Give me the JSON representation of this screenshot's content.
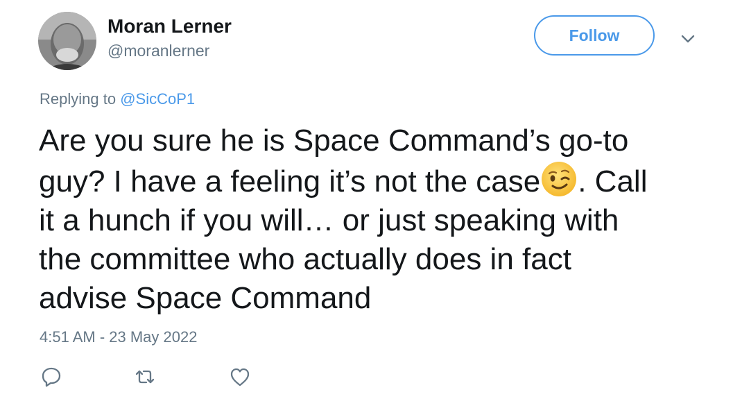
{
  "author": {
    "display_name": "Moran Lerner",
    "handle": "@moranlerner"
  },
  "header": {
    "follow_label": "Follow"
  },
  "reply": {
    "prefix": "Replying to ",
    "mention": "@SicCoP1"
  },
  "tweet": {
    "lines": [
      "Are you sure he is Space Command’s go-to",
      "guy? I have a feeling it’s not the case",
      ". Call",
      "it a hunch if you will… or just speaking with",
      "the committee who actually does in fact",
      "advise Space Command"
    ],
    "emoji_name": "winking-face"
  },
  "timestamp": "4:51 AM - 23 May 2022",
  "actions": {
    "icons": [
      "reply-icon",
      "retweet-icon",
      "like-icon"
    ]
  },
  "colors": {
    "accent": "#4a99e9",
    "text": "#14171a",
    "secondary": "#657786",
    "action_icon": "#657786"
  }
}
